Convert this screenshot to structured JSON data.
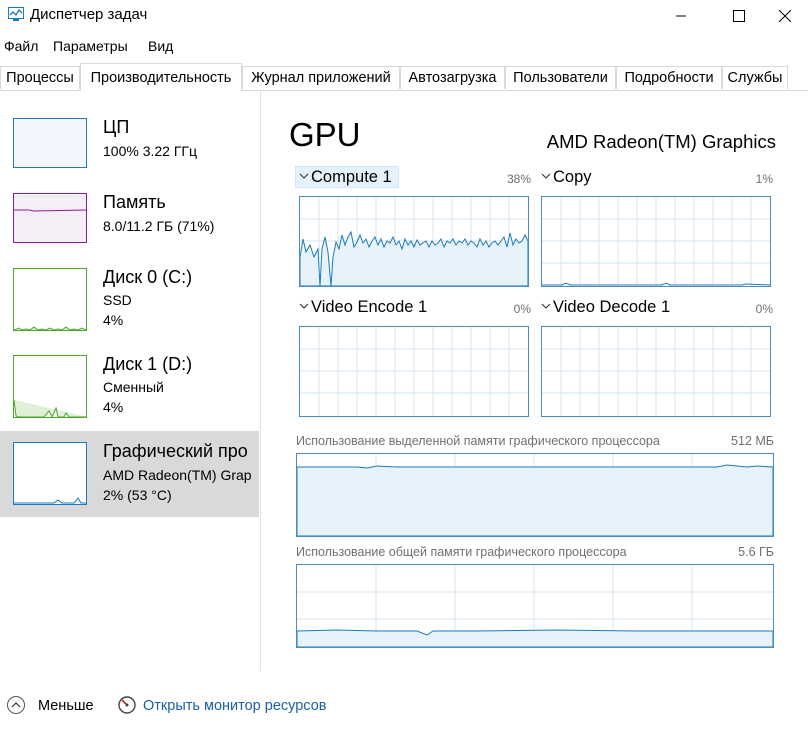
{
  "window": {
    "title": "Диспетчер задач"
  },
  "menu": [
    "Файл",
    "Параметры",
    "Вид"
  ],
  "tabs": [
    "Процессы",
    "Производительность",
    "Журнал приложений",
    "Автозагрузка",
    "Пользователи",
    "Подробности",
    "Службы"
  ],
  "active_tab": "Производительность",
  "resources": [
    {
      "title": "ЦП",
      "line1": "100%  3.22 ГГц",
      "line2": "",
      "color": "#1a7bbf"
    },
    {
      "title": "Память",
      "line1": "8.0/11.2 ГБ (71%)",
      "line2": "",
      "color": "#8b1a9c"
    },
    {
      "title": "Диск 0 (C:)",
      "line1": "SSD",
      "line2": "4%",
      "color": "#4ca62a"
    },
    {
      "title": "Диск 1 (D:)",
      "line1": "Сменный",
      "line2": "4%",
      "color": "#4ca62a"
    },
    {
      "title": "Графический про",
      "line1": "AMD Radeon(TM) Grap",
      "line2": "2%  (53 °C)",
      "color": "#1a7bbf",
      "selected": true
    }
  ],
  "gpu": {
    "title": "GPU",
    "name": "AMD Radeon(TM) Graphics",
    "engines": [
      {
        "label": "Compute 1",
        "percent": "38%"
      },
      {
        "label": "Copy",
        "percent": "1%"
      },
      {
        "label": "Video Encode 1",
        "percent": "0%"
      },
      {
        "label": "Video Decode 1",
        "percent": "0%"
      }
    ],
    "dedicated_memory": {
      "label": "Использование выделенной памяти графического процессора",
      "value": "512 МБ"
    },
    "shared_memory": {
      "label": "Использование общей памяти графического процессора",
      "value": "5.6 ГБ"
    }
  },
  "footer": {
    "less": "Меньше",
    "monitor": "Открыть монитор ресурсов"
  },
  "colors": {
    "gpu_line": "#1a7bbf",
    "graph_border": "#4e8bbd",
    "graph_fill": "#e8f2fa",
    "link": "#1a5fa8"
  }
}
